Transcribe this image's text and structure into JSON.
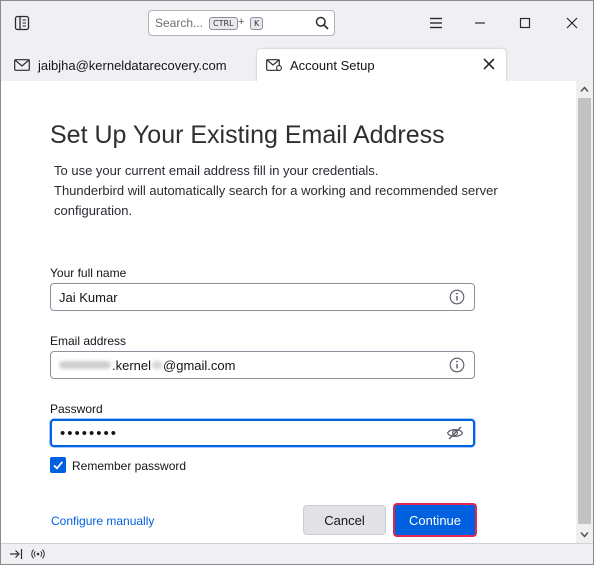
{
  "titlebar": {
    "search_placeholder": "Search...",
    "shortcut_ctrl": "CTRL",
    "shortcut_plus": "+",
    "shortcut_key": "K"
  },
  "tabs": [
    {
      "label": "jaibjha@kerneldatarecovery.com",
      "icon": "mail-icon"
    },
    {
      "label": "Account Setup",
      "icon": "account-setup-icon",
      "active": true
    }
  ],
  "setup": {
    "heading": "Set Up Your Existing Email Address",
    "intro_line1": "To use your current email address fill in your credentials.",
    "intro_line2": "Thunderbird will automatically search for a working and recommended server configuration.",
    "name_label": "Your full name",
    "name_value": "Jai Kumar",
    "email_label": "Email address",
    "email_value_visible_mid": ".kernel",
    "email_value_visible_end": "@gmail.com",
    "password_label": "Password",
    "password_value": "••••••••",
    "remember_label": "Remember password",
    "remember_checked": true,
    "configure_link": "Configure manually",
    "cancel_label": "Cancel",
    "continue_label": "Continue"
  },
  "colors": {
    "accent": "#0061e0",
    "highlight_border": "#e22850",
    "chrome_bg": "#f0f0f4"
  }
}
